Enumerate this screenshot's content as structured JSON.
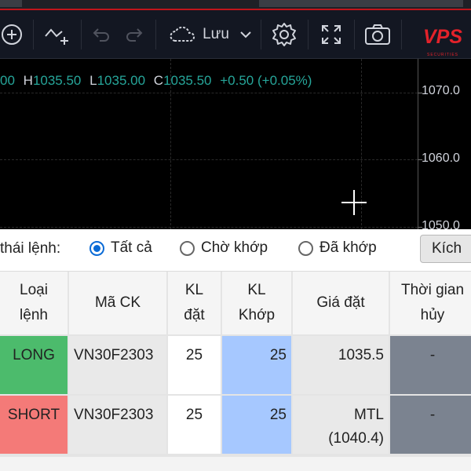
{
  "toolbar": {
    "save_label": "Lưu",
    "icons": [
      "add-circle-icon",
      "indicator-icon",
      "undo-icon",
      "redo-icon",
      "cloud-icon",
      "chevron-down-icon",
      "gear-icon",
      "fullscreen-icon",
      "camera-icon"
    ]
  },
  "logo": {
    "text": "VPS",
    "subtext": "SECURITIES"
  },
  "chart": {
    "ohlc": {
      "open_fragment": "00",
      "high_label": "H",
      "high": "1035.50",
      "low_label": "L",
      "low": "1035.00",
      "close_label": "C",
      "close": "1035.50",
      "change": "+0.50 (+0.05%)"
    },
    "price_ticks": [
      "1070.0",
      "1060.0",
      "1050.0"
    ],
    "colors": {
      "up": "#26a69a",
      "background": "#000000"
    }
  },
  "filter": {
    "label": "thái lệnh:",
    "options": [
      {
        "label": "Tất cả",
        "checked": true
      },
      {
        "label": "Chờ khớp",
        "checked": false
      },
      {
        "label": "Đã khớp",
        "checked": false
      }
    ],
    "cancel_button": "Kích"
  },
  "table": {
    "headers": {
      "type_line1": "Loại",
      "type_line2": "lệnh",
      "symbol": "Mã CK",
      "qty_line1": "KL",
      "qty_line2": "đặt",
      "matched_line1": "KL",
      "matched_line2": "Khớp",
      "price": "Giá đặt",
      "cancel_time_line1": "Thời gian",
      "cancel_time_line2": "hủy"
    },
    "rows": [
      {
        "type": "LONG",
        "symbol": "VN30F2303",
        "qty": "25",
        "matched": "25",
        "price_line1": "1035.5",
        "price_line2": "",
        "cancel_time": "-"
      },
      {
        "type": "SHORT",
        "symbol": "VN30F2303",
        "qty": "25",
        "matched": "25",
        "price_line1": "MTL",
        "price_line2": "(1040.4)",
        "cancel_time": "-"
      }
    ],
    "colors": {
      "long": "#4cbb6c",
      "short": "#f47a78",
      "matched": "#a6c8ff",
      "cancel": "#7b8390",
      "cell": "#e9e9e9"
    }
  }
}
